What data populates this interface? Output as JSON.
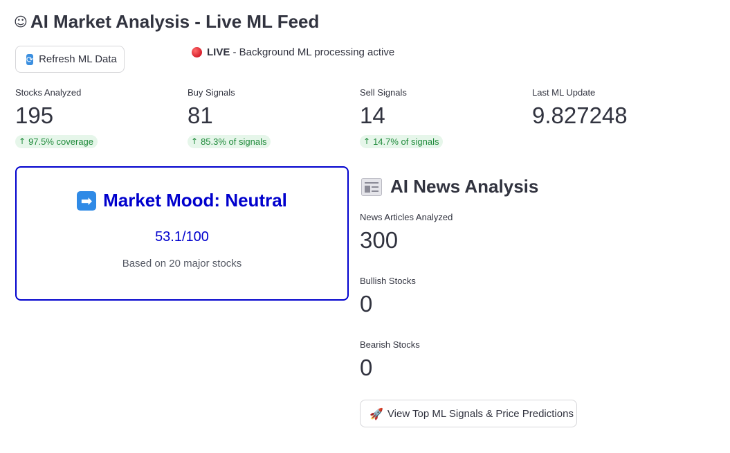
{
  "header": {
    "icon": "robot-face-icon",
    "title": "AI Market Analysis - Live ML Feed"
  },
  "toolbar": {
    "refresh_label": "Refresh ML Data",
    "refresh_icon": "refresh-icon"
  },
  "status": {
    "live_label": "LIVE",
    "live_text": " - Background ML processing active",
    "live_color": "#d61f2c"
  },
  "metrics": [
    {
      "label": "Stocks Analyzed",
      "value": "195",
      "delta": "97.5% coverage"
    },
    {
      "label": "Buy Signals",
      "value": "81",
      "delta": "85.3% of signals"
    },
    {
      "label": "Sell Signals",
      "value": "14",
      "delta": "14.7% of signals"
    },
    {
      "label": "Last ML Update",
      "value": "9.827248"
    }
  ],
  "mood": {
    "icon": "right-arrow-icon",
    "title": "Market Mood: Neutral",
    "score": "53.1/100",
    "subtitle": "Based on 20 major stocks",
    "accent_color": "#0000cd"
  },
  "news": {
    "icon": "newspaper-icon",
    "title": "AI News Analysis",
    "metrics": [
      {
        "label": "News Articles Analyzed",
        "value": "300"
      },
      {
        "label": "Bullish Stocks",
        "value": "0"
      },
      {
        "label": "Bearish Stocks",
        "value": "0"
      }
    ],
    "view_button_label": "View Top ML Signals & Price Predictions",
    "view_button_icon": "rocket-icon"
  },
  "colors": {
    "delta_bg": "#e6f6ea",
    "delta_text": "#1e8a3a",
    "text": "#31333f"
  }
}
